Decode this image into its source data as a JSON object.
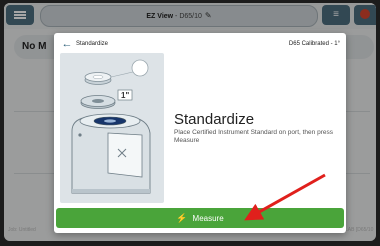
{
  "app": {
    "title_main": "EZ View",
    "title_sub": " - D65/10"
  },
  "background": {
    "card_text": "No M",
    "footer_left": "Job: Untitled",
    "footer_right": "LAB [D65/10"
  },
  "modal": {
    "title": "Standardize",
    "calibration": "D65 Calibrated - 1°",
    "heading": "Standardize",
    "description": "Place Certified Instrument Standard on port, then press Measure",
    "measure_label": "Measure",
    "badge": "1\""
  },
  "icons": {
    "menu": "menu-icon",
    "edit": "pencil-icon",
    "filter": "filter-list-icon",
    "back": "arrow-left-icon",
    "bolt": "lightning-bolt-icon"
  },
  "colors": {
    "accent": "#4d6f80",
    "measure": "#4aa43a",
    "arrow": "#e0201c"
  }
}
